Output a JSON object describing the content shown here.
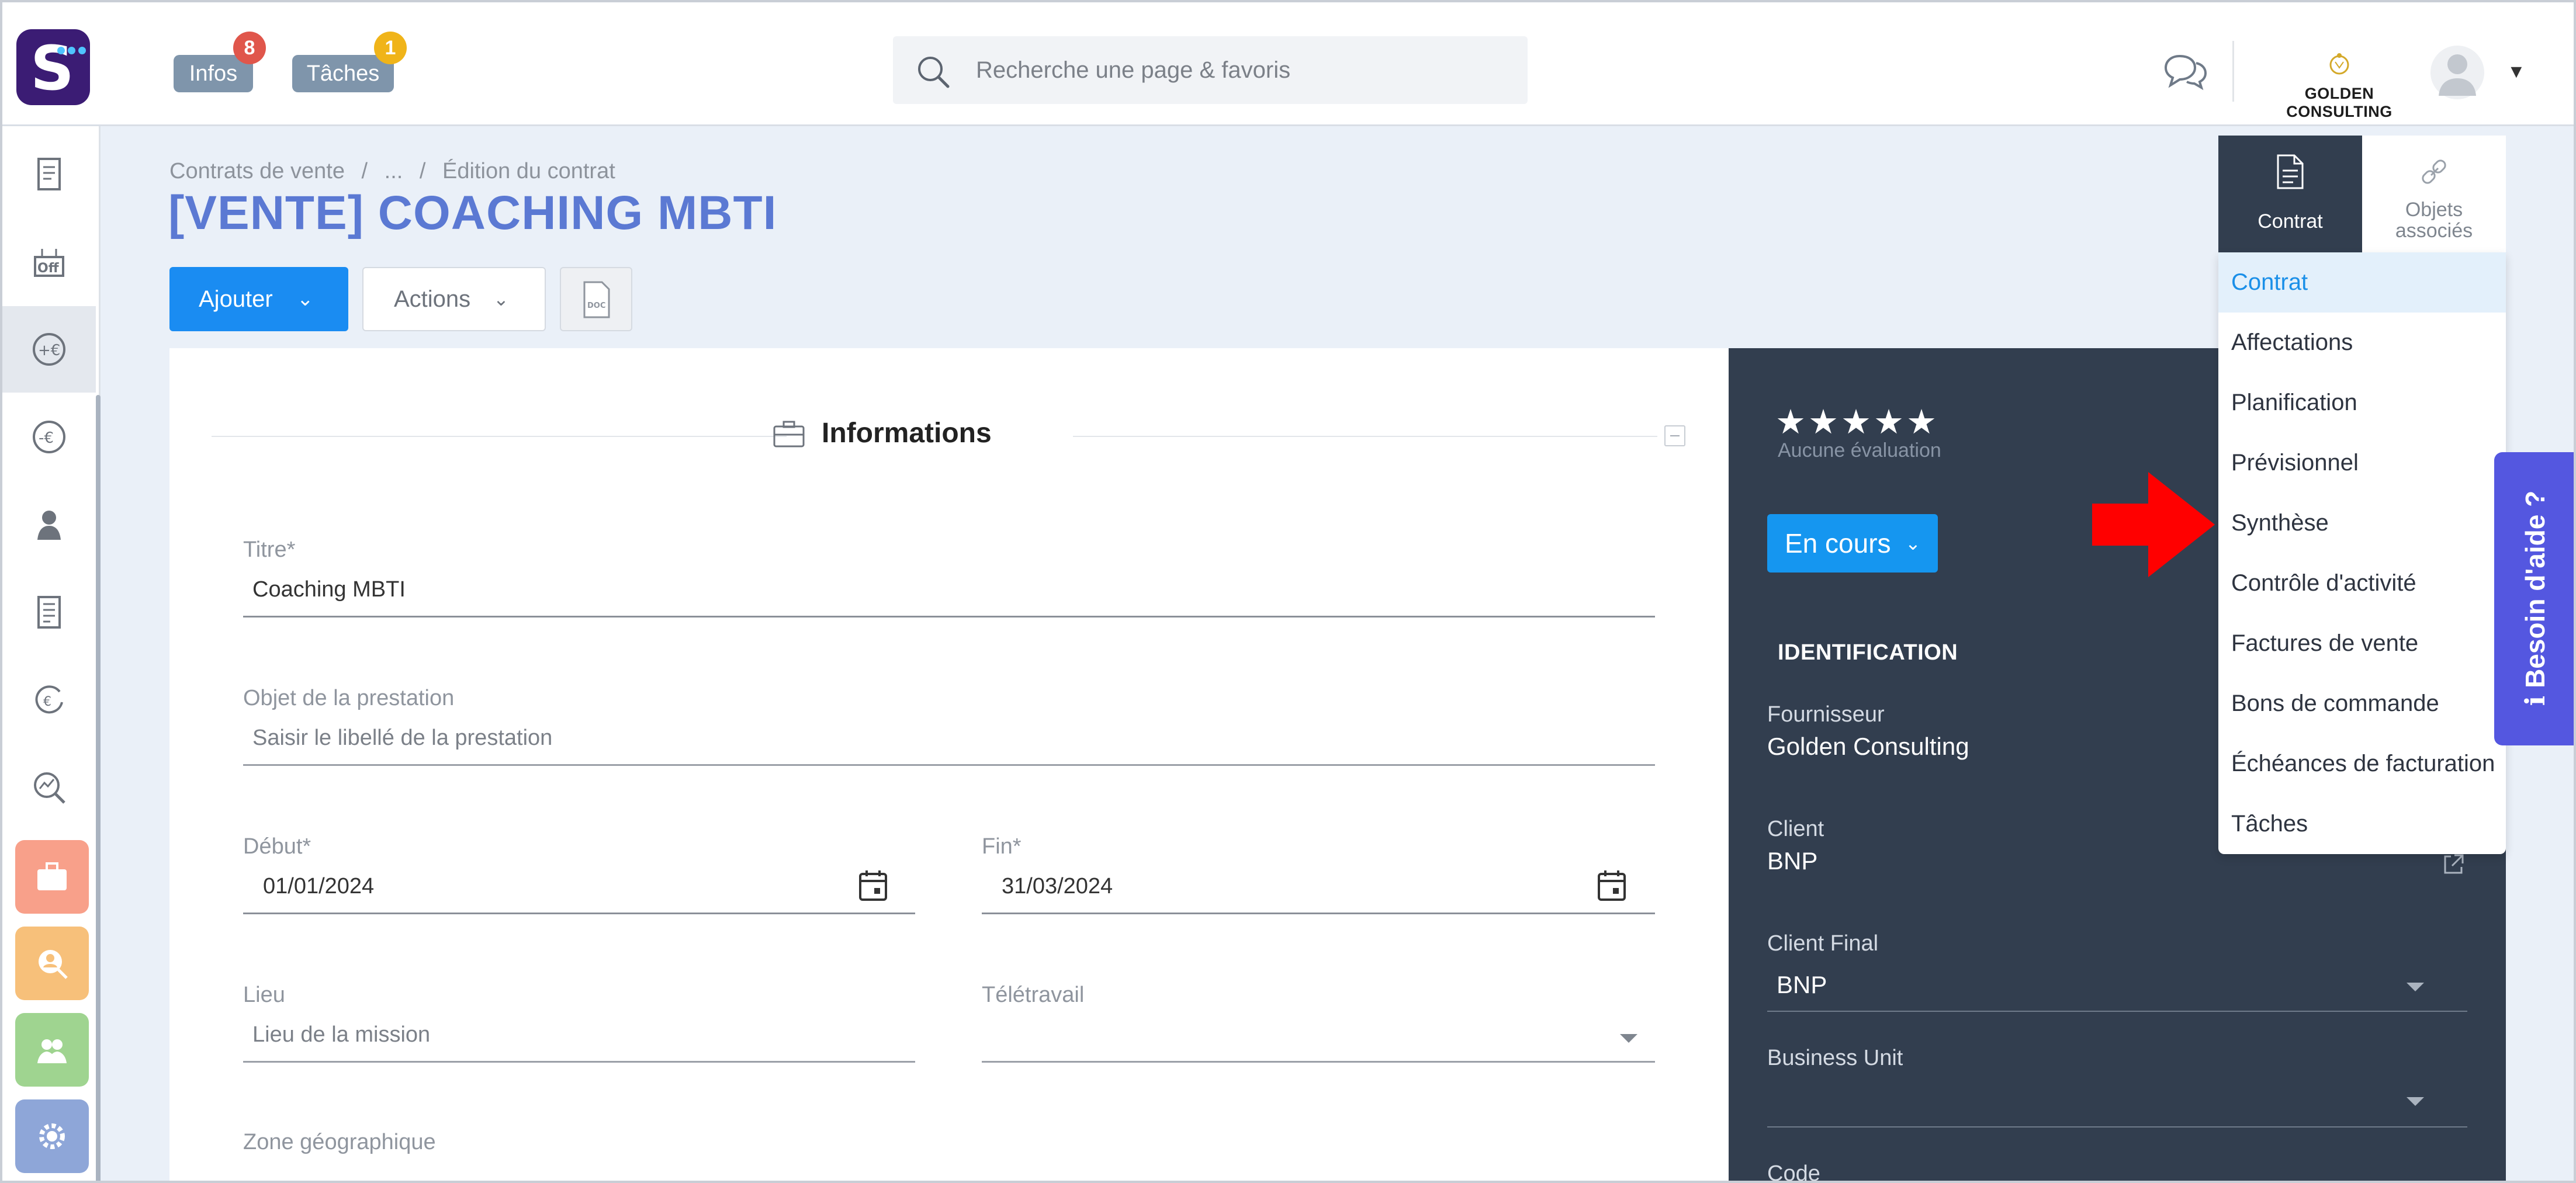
{
  "topbar": {
    "logo_letter": "S",
    "infos_label": "Infos",
    "infos_count": "8",
    "taches_label": "Tâches",
    "taches_count": "1",
    "search_placeholder": "Recherche une page & favoris",
    "company_name": "GOLDEN CONSULTING"
  },
  "sidebar": {
    "items": [
      {
        "icon": "receipt-icon"
      },
      {
        "icon": "offers-icon"
      },
      {
        "icon": "plus-euro-icon",
        "active": true
      },
      {
        "icon": "minus-euro-icon"
      },
      {
        "icon": "consultant-icon"
      },
      {
        "icon": "invoice-icon"
      },
      {
        "icon": "euro-cycle-icon"
      },
      {
        "icon": "analytics-icon"
      },
      {
        "icon": "briefcase-icon",
        "color": "#f8a08a"
      },
      {
        "icon": "user-search-icon",
        "color": "#f7c07a"
      },
      {
        "icon": "team-icon",
        "color": "#9fd490"
      },
      {
        "icon": "settings-icon",
        "color": "#8ea6d8"
      }
    ]
  },
  "breadcrumb": {
    "part1": "Contrats de vente",
    "sep1": "/",
    "part2": "...",
    "sep2": "/",
    "part3": "Édition du contrat"
  },
  "page": {
    "title": "[VENTE] COACHING MBTI"
  },
  "toolbar": {
    "add_label": "Ajouter",
    "actions_label": "Actions",
    "doc_icon": "doc-file-icon"
  },
  "form": {
    "section_title": "Informations",
    "titre": {
      "label": "Titre*",
      "value": "Coaching MBTI"
    },
    "objet": {
      "label": "Objet de la prestation",
      "placeholder": "Saisir le libellé de la prestation"
    },
    "debut": {
      "label": "Début*",
      "value": "01/01/2024"
    },
    "fin": {
      "label": "Fin*",
      "value": "31/03/2024"
    },
    "lieu": {
      "label": "Lieu",
      "placeholder": "Lieu de la mission"
    },
    "teletravail": {
      "label": "Télétravail",
      "value": ""
    },
    "zone": {
      "label": "Zone géographique"
    }
  },
  "panel": {
    "stars": "★★★★★",
    "rating_text": "Aucune évaluation",
    "status": "En cours",
    "section": "IDENTIFICATION",
    "fournisseur": {
      "label": "Fournisseur",
      "value": "Golden Consulting"
    },
    "client": {
      "label": "Client",
      "value": "BNP"
    },
    "client_final": {
      "label": "Client Final",
      "value": "BNP"
    },
    "business_unit": {
      "label": "Business Unit",
      "value": ""
    },
    "code": {
      "label": "Code"
    }
  },
  "nav": {
    "tabs": [
      {
        "label": "Contrat",
        "icon": "document-icon"
      },
      {
        "label_line1": "Objets",
        "label_line2": "associés",
        "icon": "link-icon"
      }
    ],
    "items": [
      "Contrat",
      "Affectations",
      "Planification",
      "Prévisionnel",
      "Synthèse",
      "Contrôle d'activité",
      "Factures de vente",
      "Bons de commande",
      "Échéances de facturation",
      "Tâches"
    ],
    "active_index": 0
  },
  "help": {
    "label": "Besoin d'aide ?"
  },
  "colors": {
    "brand": "#3b1c74",
    "title_blue": "#5b79d3",
    "primary_button": "#1a8cf2",
    "dark_panel": "#323e4f",
    "help_tab": "#5457e0",
    "badge_infos": "#e0564b",
    "badge_taches": "#f0b419",
    "annotation_arrow": "#ff0000"
  }
}
